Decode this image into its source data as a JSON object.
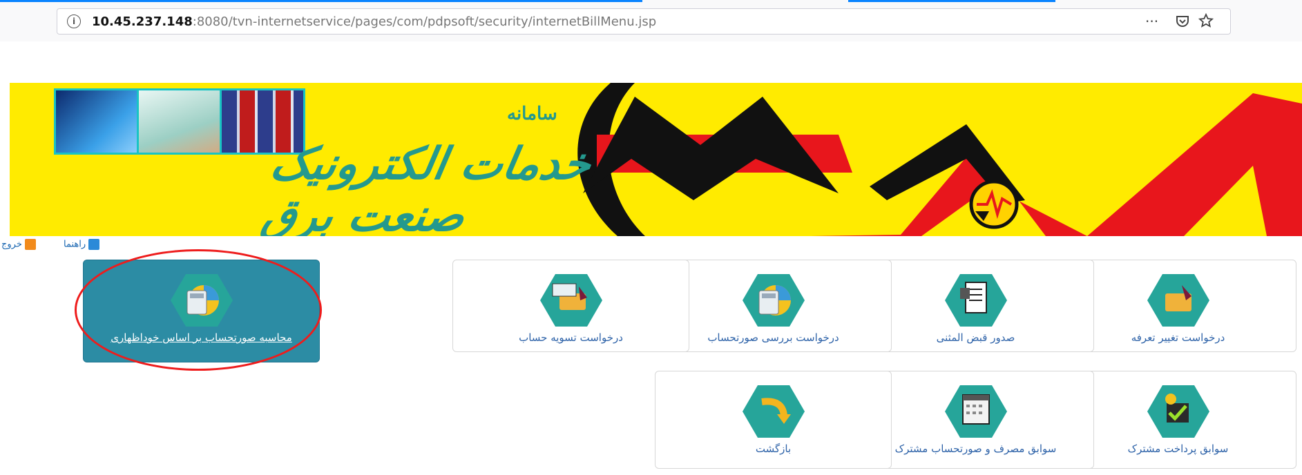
{
  "browser": {
    "url_host": "10.45.237.148",
    "url_path": ":8080/tvn-internetservice/pages/com/pdpsoft/security/internetBillMenu.jsp",
    "more_glyph": "···",
    "info_glyph": "i",
    "accent": "#0a84ff"
  },
  "banner": {
    "small_text": "سامانه",
    "calligraphy": "خدمات الکترونیک صنعت برق",
    "colors": {
      "yellow": "#ffeb00",
      "red": "#e8161c",
      "black": "#111111",
      "teal": "#19c4c4"
    }
  },
  "toplinks": {
    "help": "راهنما",
    "exit": "خروج"
  },
  "tiles": [
    {
      "label": "درخواست تغییر تعرفه",
      "icon": "folder-pen-icon",
      "active": false
    },
    {
      "label": "صدور قبض المثنی",
      "icon": "receipt-printer-icon",
      "active": false
    },
    {
      "label": "درخواست بررسی صورتحساب",
      "icon": "calculator-chart-icon",
      "active": false
    },
    {
      "label": "درخواست تسویه حساب",
      "icon": "wallet-card-icon",
      "active": false
    },
    {
      "label": "محاسبه صورتحساب بر اساس خوداظهاری",
      "icon": "calculator-chart-icon",
      "active": true
    },
    {
      "label": "سوابق پرداخت مشترک",
      "icon": "checklist-coins-icon",
      "active": false
    },
    {
      "label": "سوابق مصرف و صورتحساب مشترک",
      "icon": "calendar-list-icon",
      "active": false
    },
    {
      "label": "بازگشت",
      "icon": "back-arrow-icon",
      "active": false
    }
  ],
  "colors": {
    "tile_hex": "#26a59a",
    "tile_active": "#2c8ca4",
    "link": "#2d62a8",
    "annotation": "#ee1c1c"
  }
}
